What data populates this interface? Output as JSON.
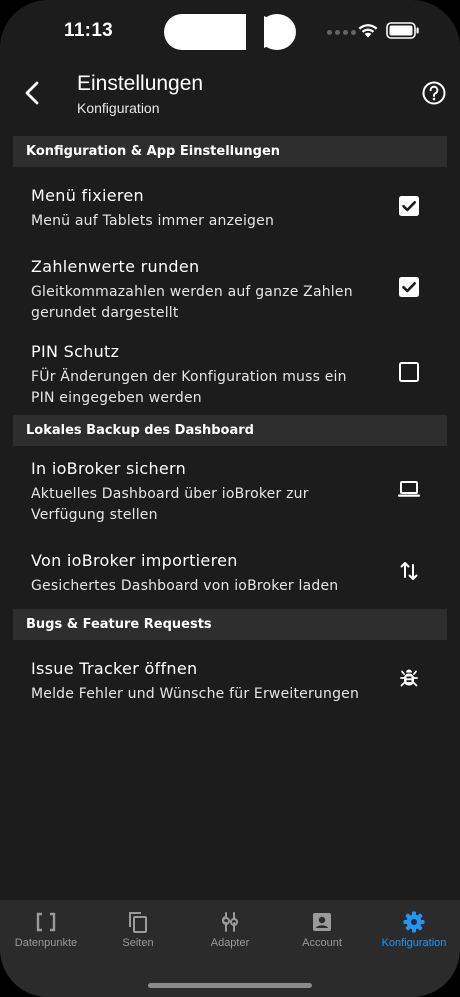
{
  "status_bar": {
    "time": "11:13"
  },
  "header": {
    "title": "Einstellungen",
    "subtitle": "Konfiguration"
  },
  "sections": [
    {
      "title": "Konfiguration & App Einstellungen",
      "items": [
        {
          "title": "Menü fixieren",
          "description": "Menü auf Tablets immer anzeigen",
          "control": "checkbox",
          "checked": true
        },
        {
          "title": "Zahlenwerte runden",
          "description": "Gleitkommazahlen werden auf ganze Zahlen gerundet dargestellt",
          "control": "checkbox",
          "checked": true
        },
        {
          "title": "PIN Schutz",
          "description": "FÜr Änderungen der Konfiguration muss ein PIN eingegeben werden",
          "control": "checkbox",
          "checked": false
        }
      ]
    },
    {
      "title": "Lokales Backup des Dashboard",
      "items": [
        {
          "title": "In ioBroker sichern",
          "description": "Aktuelles Dashboard über ioBroker zur Verfügung stellen",
          "control": "laptop-icon"
        },
        {
          "title": "Von ioBroker importieren",
          "description": "Gesichertes Dashboard von ioBroker laden",
          "control": "swap-vertical-icon"
        }
      ]
    },
    {
      "title": "Bugs & Feature Requests",
      "items": [
        {
          "title": "Issue Tracker öffnen",
          "description": "Melde Fehler und Wünsche für Erweiterungen",
          "control": "bug-icon"
        }
      ]
    }
  ],
  "bottom_nav": [
    {
      "label": "Datenpunkte",
      "icon": "brackets-icon",
      "active": false
    },
    {
      "label": "Seiten",
      "icon": "copy-pages-icon",
      "active": false
    },
    {
      "label": "Adapter",
      "icon": "adapter-plug-icon",
      "active": false
    },
    {
      "label": "Account",
      "icon": "account-box-icon",
      "active": false
    },
    {
      "label": "Konfiguration",
      "icon": "gear-icon",
      "active": true
    }
  ],
  "colors": {
    "background": "#1c1c1c",
    "section_header": "#2e2e2e",
    "nav_background": "#2b2b2b",
    "accent": "#2196f3",
    "nav_inactive": "#9a9a9a"
  }
}
